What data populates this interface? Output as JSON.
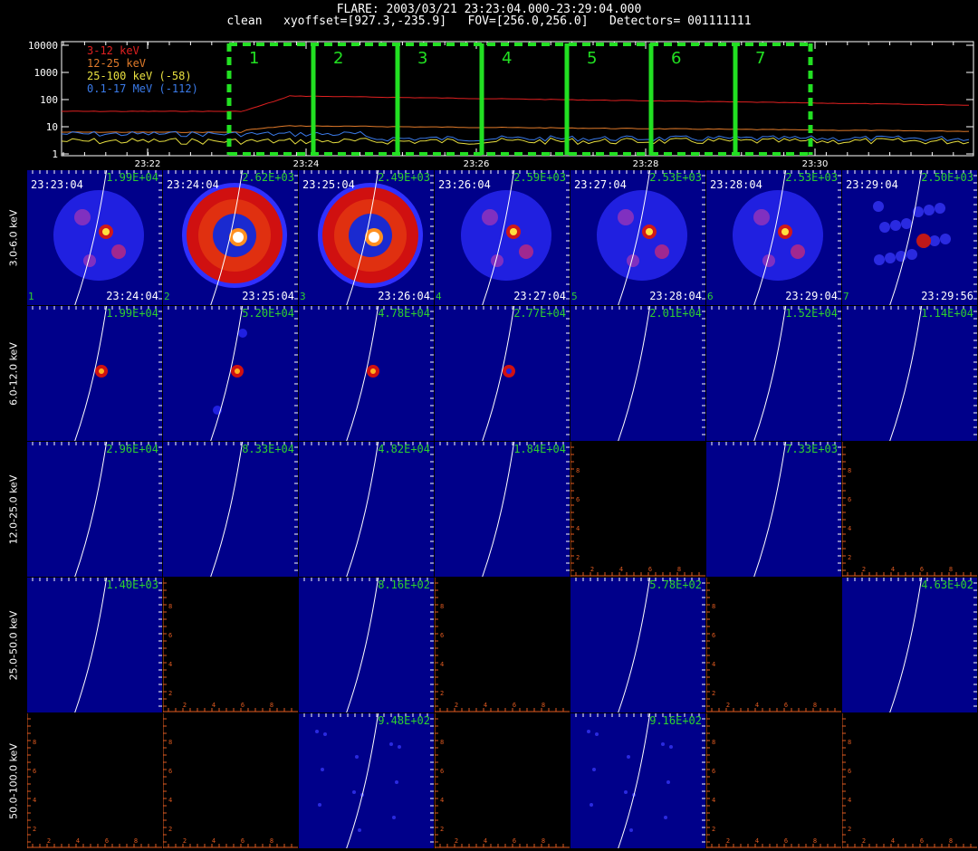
{
  "header": {
    "line1": "FLARE: 2003/03/21 23:23:04.000-23:29:04.000",
    "line2": "clean   xyoffset=[927.3,-235.9]   FOV=[256.0,256.0]   Detectors= 001111111"
  },
  "lightcurve": {
    "yticks": [
      "10000",
      "1000",
      "100",
      "10",
      "1"
    ],
    "xticks": [
      "23:22",
      "23:24",
      "23:26",
      "23:28",
      "23:30"
    ],
    "legend": [
      {
        "label": "3-12 keV",
        "color": "#e02020"
      },
      {
        "label": "12-25 keV",
        "color": "#e07a2a"
      },
      {
        "label": "25-100 keV (-58)",
        "color": "#e8e040"
      },
      {
        "label": "0.1-17 MeV (-112)",
        "color": "#3a7ae8"
      }
    ],
    "intervals": [
      "1",
      "2",
      "3",
      "4",
      "5",
      "6",
      "7"
    ],
    "interval_color": "#22e022"
  },
  "energy_bands": [
    "3.0-6.0 keV",
    "6.0-12.0 keV",
    "12.0-25.0 keV",
    "25.0-50.0 keV",
    "50.0-100.0 keV"
  ],
  "start_times": [
    "23:23:04",
    "23:24:04",
    "23:25:04",
    "23:26:04",
    "23:27:04",
    "23:28:04",
    "23:29:04"
  ],
  "end_times": [
    "23:24:04",
    "23:25:04",
    "23:26:04",
    "23:27:04",
    "23:28:04",
    "23:29:04",
    "23:29:56"
  ],
  "interval_numbers": [
    "1",
    "2",
    "3",
    "4",
    "5",
    "6",
    "7"
  ],
  "axis_ticks": [
    "2",
    "4",
    "6",
    "8"
  ],
  "peaks": [
    [
      "1.99E+04",
      "2.62E+03",
      "2.49E+03",
      "2.59E+03",
      "2.53E+03",
      "2.53E+03",
      "2.50E+03"
    ],
    [
      "1.99E+04",
      "5.20E+04",
      "4.78E+04",
      "2.77E+04",
      "2.01E+04",
      "1.52E+04",
      "1.14E+04"
    ],
    [
      "2.96E+04",
      "8.33E+04",
      "4.82E+04",
      "1.84E+04",
      "",
      "7.33E+03",
      ""
    ],
    [
      "1.40E+03",
      "",
      "8.16E+02",
      "",
      "5.78E+02",
      "",
      "4.63E+02"
    ],
    [
      "",
      "",
      "9.48E+02",
      "",
      "9.16E+02",
      "",
      ""
    ]
  ],
  "colors": {
    "background": "#000000",
    "map_fill": "#00008a",
    "limb": "#ffffff",
    "axis_orange": "#e05a20",
    "peak_text": "#2fd02f"
  }
}
